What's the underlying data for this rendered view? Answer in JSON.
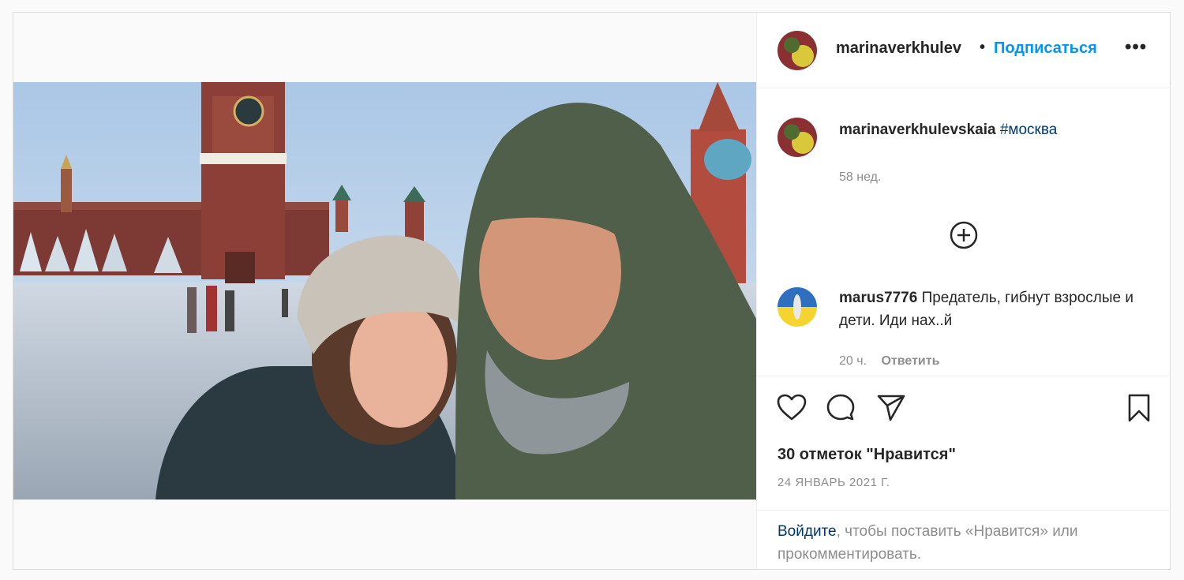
{
  "post": {
    "author": "marinaverkhulev",
    "dot": "•",
    "follow_label": "Подписаться",
    "more_label": "•••"
  },
  "caption": {
    "user": "marinaverkhulevskaia",
    "hashtag": "#москва",
    "age": "58 нед."
  },
  "load_more_icon": "plus-circle-icon",
  "comment": {
    "user": "marus7776",
    "text": "Предатель, гибнут взрослые и дети. Иди нах..й",
    "age": "20 ч.",
    "reply_label": "Ответить"
  },
  "likes_text": "30 отметок \"Нравится\"",
  "date_text": "24 ЯНВАРЬ 2021 Г.",
  "login": {
    "link_label": "Войдите",
    "rest_text": ", чтобы поставить «Нравится» или прокомментировать."
  },
  "icons": [
    "heart-icon",
    "comment-icon",
    "share-icon",
    "bookmark-icon"
  ],
  "colors": {
    "accent": "#0095f6",
    "link": "#00376b",
    "muted": "#8e8e8e"
  }
}
